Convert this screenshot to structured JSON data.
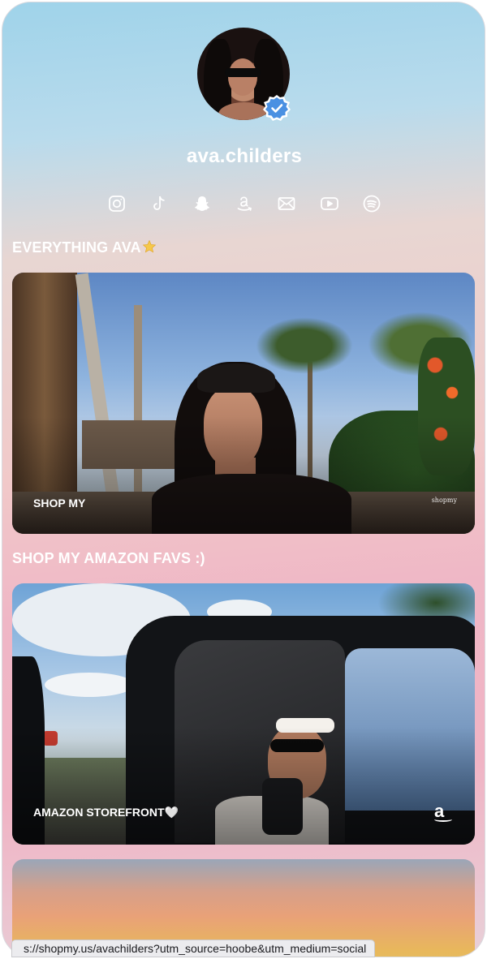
{
  "profile": {
    "username": "ava.childers",
    "verified_icon": "verified-badge-icon"
  },
  "socials": [
    {
      "name": "instagram-icon"
    },
    {
      "name": "tiktok-icon"
    },
    {
      "name": "snapchat-icon"
    },
    {
      "name": "amazon-icon"
    },
    {
      "name": "email-icon"
    },
    {
      "name": "youtube-icon"
    },
    {
      "name": "spotify-icon"
    }
  ],
  "sections": [
    {
      "title": "EVERYTHING AVA",
      "emoji": "star-icon",
      "card": {
        "label": "SHOP MY",
        "watermark": "shopmy"
      }
    },
    {
      "title": "SHOP MY AMAZON FAVS :)",
      "card": {
        "label": "AMAZON STOREFRONT🤍",
        "watermark": "a"
      }
    }
  ],
  "status_bar": {
    "url": "s://shopmy.us/avachilders?utm_source=hoobe&utm_medium=social"
  },
  "colors": {
    "accent_verified": "#4a90e2",
    "text": "#ffffff",
    "gradient_top": "#9fd3ea",
    "gradient_bottom": "#f0b3c4"
  }
}
